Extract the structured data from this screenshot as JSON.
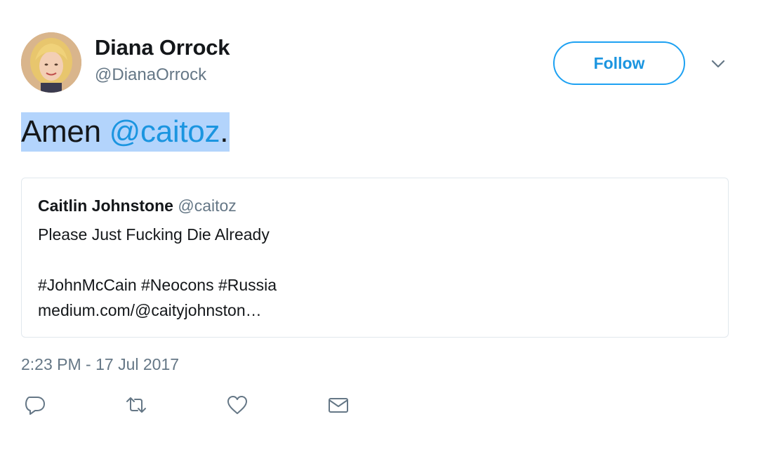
{
  "author": {
    "name": "Diana Orrock",
    "handle": "@DianaOrrock"
  },
  "follow_button": {
    "label": "Follow"
  },
  "tweet": {
    "text_before": "Amen ",
    "mention": "@caitoz",
    "text_after": "."
  },
  "quoted_tweet": {
    "author_name": "Caitlin Johnstone",
    "author_handle": "@caitoz",
    "lines": [
      "Please Just Fucking Die Already",
      "",
      "#JohnMcCain #Neocons #Russia",
      "medium.com/@caityjohnston…"
    ]
  },
  "timestamp": "2:23 PM - 17 Jul 2017",
  "icons": {
    "menu": "chevron-down-icon",
    "reply": "reply-icon",
    "retweet": "retweet-icon",
    "like": "heart-icon",
    "dm": "envelope-icon"
  },
  "colors": {
    "accent": "#1da1f2",
    "link": "#1b95e0",
    "secondary_text": "#657786",
    "highlight": "#b3d4fc",
    "border": "#e1e8ed"
  }
}
